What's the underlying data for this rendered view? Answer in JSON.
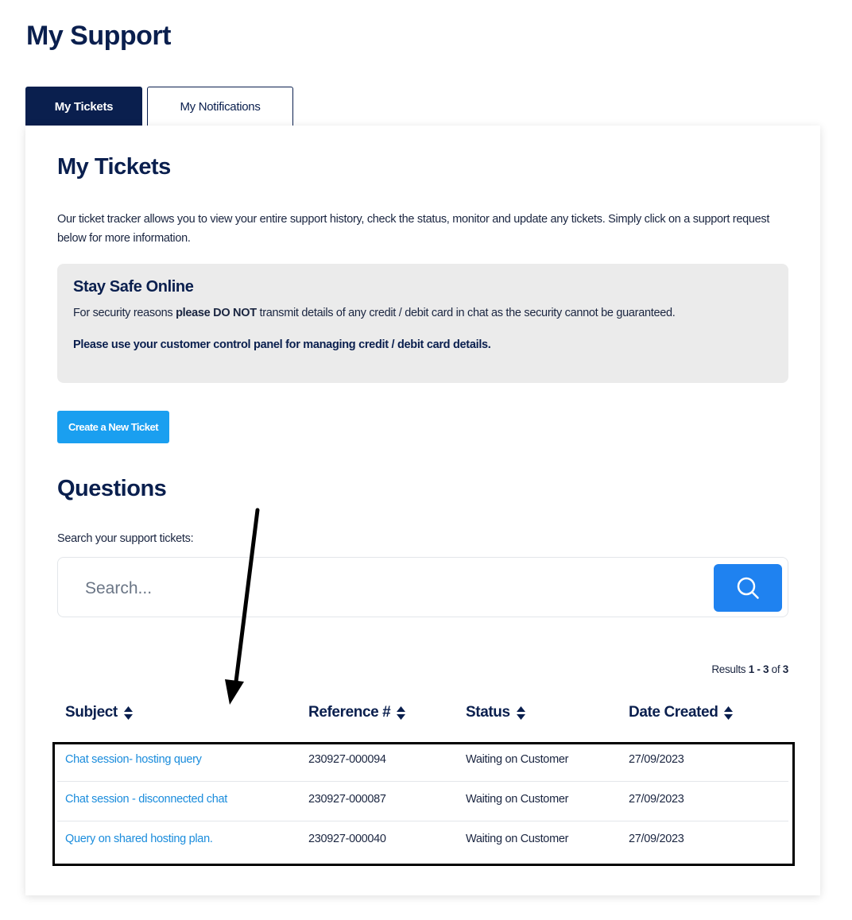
{
  "page": {
    "title": "My Support"
  },
  "tabs": [
    {
      "label": "My Tickets",
      "active": true
    },
    {
      "label": "My Notifications",
      "active": false
    }
  ],
  "card": {
    "title": "My Tickets",
    "intro": "Our ticket tracker allows you to view your entire support history, check the status, monitor and update any tickets. Simply click on a support request below for more information.",
    "notice": {
      "title": "Stay Safe Online",
      "line1_before": "For security reasons ",
      "line1_bold": "please DO NOT",
      "line1_after": " transmit details of any credit / debit card in chat as the security cannot be guaranteed.",
      "line2": "Please use your customer control panel for managing credit / debit card details."
    },
    "create_button": "Create a New Ticket"
  },
  "questions": {
    "title": "Questions",
    "search_label": "Search your support tickets:",
    "search_placeholder": "Search...",
    "search_button_icon": "search-icon",
    "results_prefix": "Results ",
    "results_range": "1 - 3",
    "results_of": " of ",
    "results_total": "3"
  },
  "table": {
    "columns": [
      "Subject",
      "Reference #",
      "Status",
      "Date Created"
    ],
    "sort_icon": "sort-icon",
    "rows": [
      {
        "subject": "Chat session- hosting query",
        "reference": "230927-000094",
        "status": "Waiting on Customer",
        "date": "27/09/2023"
      },
      {
        "subject": "Chat session - disconnected chat",
        "reference": "230927-000087",
        "status": "Waiting on Customer",
        "date": "27/09/2023"
      },
      {
        "subject": "Query on shared hosting plan.",
        "reference": "230927-000040",
        "status": "Waiting on Customer",
        "date": "27/09/2023"
      }
    ]
  },
  "annotation": {
    "arrow_icon": "arrow-icon",
    "highlight": "highlight-box"
  },
  "colors": {
    "navy": "#0a1f4e",
    "accent": "#1a9ff0",
    "search_button": "#1f82f0",
    "link": "#1a8cdc",
    "notice_bg": "#ebebeb"
  }
}
